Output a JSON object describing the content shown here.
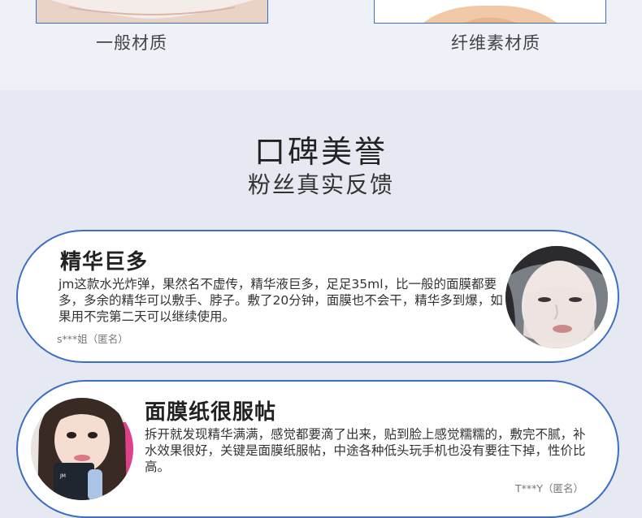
{
  "materials": {
    "left_caption": "一般材质",
    "right_caption": "纤维素材质"
  },
  "section": {
    "title": "口碑美誉",
    "subtitle": "粉丝真实反馈"
  },
  "reviews": [
    {
      "title": "精华巨多",
      "body": "jm这款水光炸弹，果然名不虚传，精华液巨多，足足35ml，比一般的面膜都要多，多余的精华可以敷手、脖子。敷了20分钟，面膜也不会干，精华多到爆，如果用不完第二天可以继续使用。",
      "user": "s***姐（匿名）"
    },
    {
      "title": "面膜纸很服帖",
      "body": "拆开就发现精华满满，感觉都要滴了出来，贴到脸上感觉糯糯的，敷完不腻，补水效果很好，关键是面膜纸服帖，中途各种低头玩手机也没有要往下掉，性价比高。",
      "user": "T***Y（匿名）"
    }
  ],
  "colors": {
    "accent": "#3a6fc5",
    "page_background": "#e6e9f1",
    "top_band": "#eef1f8"
  }
}
